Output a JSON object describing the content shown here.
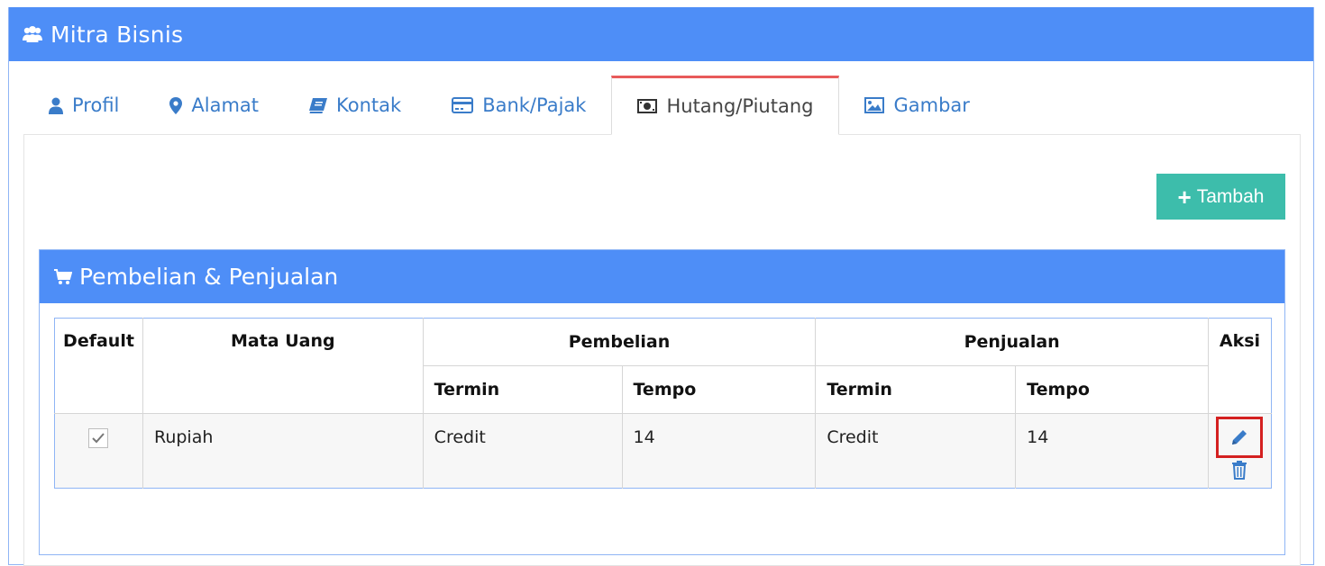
{
  "header": {
    "title": "Mitra Bisnis",
    "icon": "users-icon"
  },
  "tabs": [
    {
      "label": "Profil",
      "icon": "user-icon",
      "active": false
    },
    {
      "label": "Alamat",
      "icon": "map-marker-icon",
      "active": false
    },
    {
      "label": "Kontak",
      "icon": "book-icon",
      "active": false
    },
    {
      "label": "Bank/Pajak",
      "icon": "credit-card-icon",
      "active": false
    },
    {
      "label": "Hutang/Piutang",
      "icon": "money-icon",
      "active": true
    },
    {
      "label": "Gambar",
      "icon": "image-icon",
      "active": false
    }
  ],
  "actions": {
    "add_label": "Tambah"
  },
  "section": {
    "title": "Pembelian & Penjualan",
    "icon": "cart-icon"
  },
  "table": {
    "headers": {
      "default": "Default",
      "currency": "Mata Uang",
      "purchase": "Pembelian",
      "sales": "Penjualan",
      "actions": "Aksi",
      "purchase_term": "Termin",
      "purchase_due": "Tempo",
      "sales_term": "Termin",
      "sales_due": "Tempo"
    },
    "rows": [
      {
        "default": true,
        "currency": "Rupiah",
        "purchase_term": "Credit",
        "purchase_due": "14",
        "sales_term": "Credit",
        "sales_due": "14"
      }
    ]
  },
  "colors": {
    "primary": "#4e8ef7",
    "success": "#3dbdab",
    "tab_active_border": "#e85a5a",
    "link": "#3a7cc9",
    "highlight": "#d42020"
  }
}
